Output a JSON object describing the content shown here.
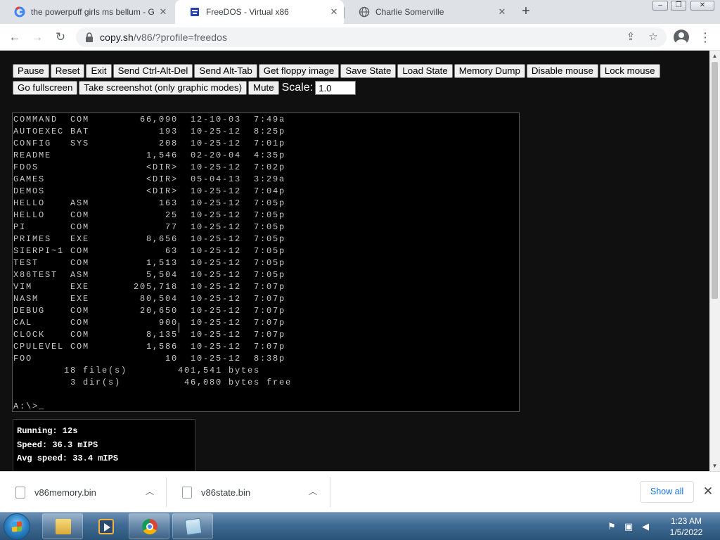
{
  "browser": {
    "tabs": [
      {
        "title": "the powerpuff girls ms bellum - G",
        "icon": "google-icon",
        "active": false
      },
      {
        "title": "FreeDOS - Virtual x86",
        "icon": "v86-icon",
        "active": true
      },
      {
        "title": "Charlie Somerville",
        "icon": "globe-icon",
        "active": false
      }
    ],
    "url": {
      "host": "copy.sh",
      "path": "/v86/?profile=freedos"
    }
  },
  "toolbar": {
    "buttons": [
      "Pause",
      "Reset",
      "Exit",
      "Send Ctrl-Alt-Del",
      "Send Alt-Tab",
      "Get floppy image",
      "Save State",
      "Load State",
      "Memory Dump",
      "Disable mouse",
      "Lock mouse",
      "Go fullscreen",
      "Take screenshot (only graphic modes)",
      "Mute"
    ],
    "scale_label": "Scale:",
    "scale_value": "1.0"
  },
  "screen": {
    "lines": [
      "COMMAND  COM        66,090  12-10-03  7:49a",
      "AUTOEXEC BAT           193  10-25-12  8:25p",
      "CONFIG   SYS           208  10-25-12  7:01p",
      "README               1,546  02-20-04  4:35p",
      "FDOS                 <DIR>  10-25-12  7:02p",
      "GAMES                <DIR>  05-04-13  3:29a",
      "DEMOS                <DIR>  10-25-12  7:04p",
      "HELLO    ASM           163  10-25-12  7:05p",
      "HELLO    COM            25  10-25-12  7:05p",
      "PI       COM            77  10-25-12  7:05p",
      "PRIMES   EXE         8,656  10-25-12  7:05p",
      "SIERPI~1 COM            63  10-25-12  7:05p",
      "TEST     COM         1,513  10-25-12  7:05p",
      "X86TEST  ASM         5,504  10-25-12  7:05p",
      "VIM      EXE       205,718  10-25-12  7:07p",
      "NASM     EXE        80,504  10-25-12  7:07p",
      "DEBUG    COM        20,650  10-25-12  7:07p",
      "CAL      COM           900  10-25-12  7:07p",
      "CLOCK    COM         8,135  10-25-12  7:07p",
      "CPULEVEL COM         1,586  10-25-12  7:07p",
      "FOO                     10  10-25-12  8:38p",
      "        18 file(s)        401,541 bytes",
      "         3 dir(s)          46,080 bytes free",
      "",
      "A:\\>_"
    ]
  },
  "stats": {
    "running": "Running: 12s",
    "speed": "Speed: 36.3 mIPS",
    "avg_speed": "Avg speed: 33.4 mIPS"
  },
  "downloads": {
    "items": [
      {
        "name": "v86memory.bin"
      },
      {
        "name": "v86state.bin"
      }
    ],
    "show_all": "Show all"
  },
  "taskbar": {
    "apps": [
      "windows-explorer-icon",
      "media-player-icon",
      "chrome-icon",
      "notepad-icon"
    ],
    "time": "1:23 AM",
    "date": "1/5/2022"
  },
  "colors": {
    "page_background": "#101010",
    "terminal_text": "#c8c8c8",
    "show_all_link": "#1a73e8"
  }
}
